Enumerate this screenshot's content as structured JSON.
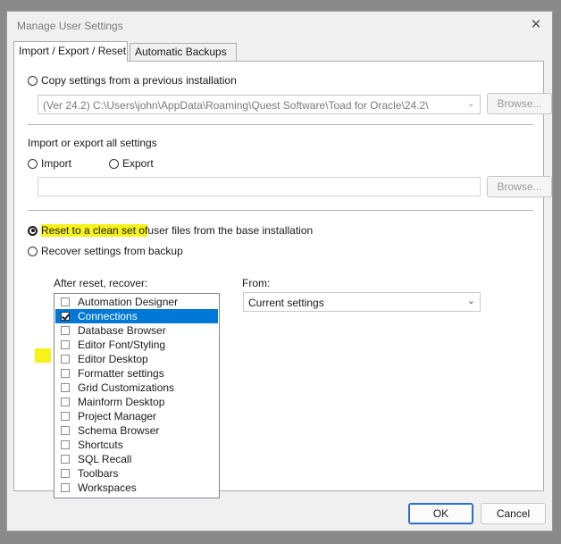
{
  "dialog": {
    "title": "Manage User Settings",
    "close_glyph": "✕"
  },
  "tabs": [
    {
      "label": "Import / Export / Reset",
      "active": true
    },
    {
      "label": "Automatic Backups",
      "active": false
    }
  ],
  "copy_section": {
    "radio_label": "Copy settings from a previous installation",
    "path_value": "(Ver 24.2) C:\\Users\\john\\AppData\\Roaming\\Quest Software\\Toad for Oracle\\24.2\\",
    "browse_label": "Browse..."
  },
  "import_export": {
    "heading": "Import or export all settings",
    "import_label": "Import",
    "export_label": "Export",
    "file_value": "",
    "browse_label": "Browse..."
  },
  "reset_section": {
    "reset_highlight": "Reset to a clean set of",
    "reset_rest": " user files from the base installation",
    "recover_label": "Recover settings from backup",
    "after_reset_label": "After reset, recover:",
    "from_label": "From:",
    "from_value": "Current settings",
    "items": [
      {
        "label": "Automation Designer",
        "checked": false,
        "selected": false
      },
      {
        "label": "Connections",
        "checked": true,
        "selected": true
      },
      {
        "label": "Database Browser",
        "checked": false,
        "selected": false
      },
      {
        "label": "Editor Font/Styling",
        "checked": false,
        "selected": false
      },
      {
        "label": "Editor Desktop",
        "checked": false,
        "selected": false
      },
      {
        "label": "Formatter settings",
        "checked": false,
        "selected": false
      },
      {
        "label": "Grid Customizations",
        "checked": false,
        "selected": false
      },
      {
        "label": "Mainform Desktop",
        "checked": false,
        "selected": false
      },
      {
        "label": "Project Manager",
        "checked": false,
        "selected": false
      },
      {
        "label": "Schema Browser",
        "checked": false,
        "selected": false
      },
      {
        "label": "Shortcuts",
        "checked": false,
        "selected": false
      },
      {
        "label": "SQL Recall",
        "checked": false,
        "selected": false
      },
      {
        "label": "Toolbars",
        "checked": false,
        "selected": false
      },
      {
        "label": "Workspaces",
        "checked": false,
        "selected": false
      }
    ]
  },
  "footer": {
    "ok_label": "OK",
    "cancel_label": "Cancel"
  },
  "colors": {
    "selection": "#0078d7",
    "highlighter": "#f6f21a",
    "default_button_border": "#2b6fc7"
  }
}
